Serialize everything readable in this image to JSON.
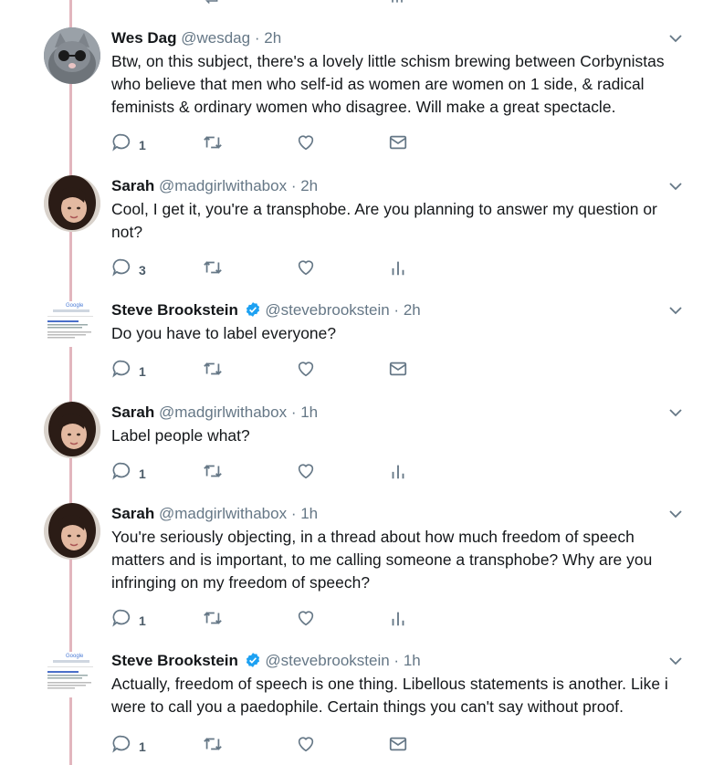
{
  "tweets": [
    {
      "name": "Wes Dag",
      "handle": "@wesdag",
      "time": "2h",
      "verified": false,
      "text": "Btw, on this subject, there's a lovely little schism brewing between Corbynistas who believe that men who self-id as women are women on 1 side, & radical feminists & ordinary women who disagree. Will make a great spectacle.",
      "reply_count": "1",
      "last_action": "message"
    },
    {
      "name": "Sarah",
      "handle": "@madgirlwithabox",
      "time": "2h",
      "verified": false,
      "text": "Cool, I get it, you're a transphobe. Are you planning to answer my question or not?",
      "reply_count": "3",
      "last_action": "analytics"
    },
    {
      "name": "Steve Brookstein",
      "handle": "@stevebrookstein",
      "time": "2h",
      "verified": true,
      "text": "Do you have to label everyone?",
      "reply_count": "1",
      "last_action": "message"
    },
    {
      "name": "Sarah",
      "handle": "@madgirlwithabox",
      "time": "1h",
      "verified": false,
      "text": "Label people what?",
      "reply_count": "1",
      "last_action": "analytics"
    },
    {
      "name": "Sarah",
      "handle": "@madgirlwithabox",
      "time": "1h",
      "verified": false,
      "text": "You're seriously objecting, in a thread about how much freedom of speech matters and is important, to me calling someone a transphobe? Why are you infringing on my freedom of speech?",
      "reply_count": "1",
      "last_action": "analytics"
    },
    {
      "name": "Steve Brookstein",
      "handle": "@stevebrookstein",
      "time": "1h",
      "verified": true,
      "text": "Actually, freedom of speech is one thing. Libellous statements is another. Like i were to call you a paedophile. Certain things you can't say without proof.",
      "reply_count": "1",
      "last_action": "message"
    }
  ],
  "header_sep": "·",
  "colors": {
    "icon": "#657786",
    "name": "#14171a",
    "meta": "#657786",
    "thread_line": "#e2b6be",
    "verified": "#1da1f2"
  }
}
